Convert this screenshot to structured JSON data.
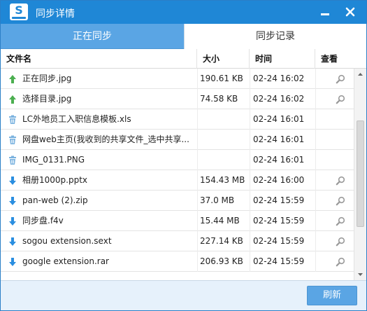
{
  "window": {
    "title": "同步详情"
  },
  "tabs": [
    {
      "label": "正在同步",
      "active": false
    },
    {
      "label": "同步记录",
      "active": true
    }
  ],
  "table": {
    "headers": {
      "name": "文件名",
      "size": "大小",
      "time": "时间",
      "view": "查看"
    },
    "rows": [
      {
        "icon": "upload-arrow-icon",
        "name": "正在同步.jpg",
        "size": "190.61 KB",
        "time": "02-24 16:02",
        "viewable": true
      },
      {
        "icon": "upload-arrow-icon",
        "name": "选择目录.jpg",
        "size": "74.58 KB",
        "time": "02-24 16:02",
        "viewable": true
      },
      {
        "icon": "trash-icon",
        "name": "LC外地员工入职信息模板.xls",
        "size": "",
        "time": "02-24 16:01",
        "viewable": false
      },
      {
        "icon": "trash-icon",
        "name": "网盘web主页(我收到的共享文件_选中共享...",
        "size": "",
        "time": "02-24 16:01",
        "viewable": false
      },
      {
        "icon": "trash-icon",
        "name": "IMG_0131.PNG",
        "size": "",
        "time": "02-24 16:01",
        "viewable": false
      },
      {
        "icon": "download-arrow-icon",
        "name": "相册1000p.pptx",
        "size": "154.43 MB",
        "time": "02-24 16:00",
        "viewable": true
      },
      {
        "icon": "download-arrow-icon",
        "name": "pan-web (2).zip",
        "size": "37.0 MB",
        "time": "02-24 15:59",
        "viewable": true
      },
      {
        "icon": "download-arrow-icon",
        "name": "同步盘.f4v",
        "size": "15.44 MB",
        "time": "02-24 15:59",
        "viewable": true
      },
      {
        "icon": "download-arrow-icon",
        "name": "sogou extension.sext",
        "size": "227.14 KB",
        "time": "02-24 15:59",
        "viewable": true
      },
      {
        "icon": "download-arrow-icon",
        "name": "google extension.rar",
        "size": "206.93 KB",
        "time": "02-24 15:59",
        "viewable": true
      }
    ]
  },
  "footer": {
    "refresh_label": "刷新"
  },
  "colors": {
    "accent": "#1f87d6",
    "tab_inactive": "#5aa5e4",
    "upload": "#4caf50",
    "download": "#2a8ee0",
    "trash": "#7ab2df"
  }
}
